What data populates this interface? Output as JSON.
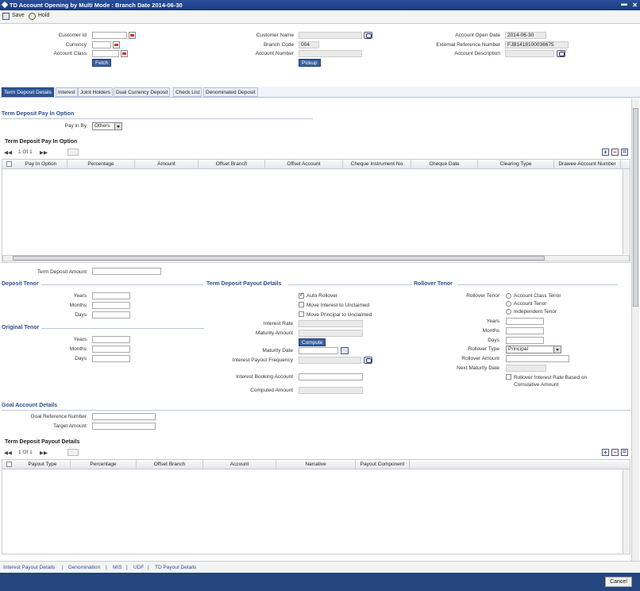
{
  "window": {
    "title": "TD Account Opening by Multi Mode : Branch Date 2014-06-30",
    "minimize": "▬",
    "close": "✕"
  },
  "toolbar": {
    "save": "Save",
    "hold": "Hold"
  },
  "header": {
    "customer_id_label": "Customer Id",
    "customer_id": "",
    "currency_label": "Currency",
    "currency": "",
    "account_class_label": "Account Class",
    "account_class": "",
    "fetch": "Fetch",
    "customer_name_label": "Customer Name",
    "customer_name": "",
    "branch_code_label": "Branch Code",
    "branch_code": "004",
    "account_number_label": "Account Number",
    "account_number": "",
    "pickup": "Pickup",
    "account_open_date_label": "Account Open Date",
    "account_open_date": "2014-06-30",
    "ext_ref_label": "External Reference Number",
    "ext_ref": "FJB1418100036675",
    "account_desc_label": "Account Description",
    "account_desc": ""
  },
  "tabs": [
    "Term Deposit Details",
    "Interest",
    "Joint Holders",
    "Dual Currency Deposit",
    "Check List",
    "Denominated Deposit"
  ],
  "payin": {
    "section": "Term Deposit Pay In Option",
    "pay_in_by_label": "Pay in By",
    "pay_in_by": "Others",
    "grid_title": "Term Deposit Pay In Option",
    "pager": "1 Of 1",
    "columns": [
      "Pay In Option",
      "Percentage",
      "Amount",
      "Offset Branch",
      "Offset Account",
      "Cheque Instrument No",
      "Cheque Date",
      "Clearing Type",
      "Drawee Account Number"
    ],
    "td_amount_label": "Term Deposit Amount",
    "td_amount": ""
  },
  "deposit_tenor": {
    "title": "Deposit Tenor",
    "years": "Years",
    "months": "Months",
    "days": "Days"
  },
  "original_tenor": {
    "title": "Original Tenor",
    "years": "Years",
    "months": "Months",
    "days": "Days"
  },
  "payout": {
    "title": "Term Deposit Payout Details",
    "auto_rollover": "Auto Rollover",
    "move_interest": "Move Interest to Unclaimed",
    "move_principal": "Move Principal to Unclaimed",
    "interest_rate": "Interest Rate",
    "maturity_amount": "Maturity Amount",
    "compute": "Compute",
    "maturity_date": "Maturity Date",
    "interest_payout_freq": "Interest Payout Frequency",
    "interest_booking_account": "Interest Booking Account",
    "computed_amount": "Computed Amount"
  },
  "rollover": {
    "title": "Rollover Tenor",
    "tenor_label": "Rollover Tenor",
    "opt1": "Account Class Tenor",
    "opt2": "Account Tenor",
    "opt3": "Independent Tenor",
    "years": "Years",
    "months": "Months",
    "days": "Days",
    "type_label": "Rollover Type",
    "type": "Principal",
    "amount_label": "Rollover Amount",
    "next_maturity_label": "Next Maturity Date",
    "rate_chk_1": "Rollover Interest Rate Based on",
    "rate_chk_2": "Cumulative Amount"
  },
  "goal": {
    "title": "Goal Account Details",
    "ref_label": "Goal Reference Number",
    "target_label": "Target Amount"
  },
  "payout_grid": {
    "title": "Term Deposit Payout Details",
    "pager": "1 Of 1",
    "columns": [
      "Payout Type",
      "Percentage",
      "Offset Branch",
      "Account",
      "Narrative",
      "Payout Component"
    ]
  },
  "footer_links": [
    "Interest Payout Details",
    "|",
    "Denomination",
    "|",
    "MIS",
    "|",
    "UDF",
    "|",
    "TD Payout Details"
  ],
  "cancel": "Cancel"
}
